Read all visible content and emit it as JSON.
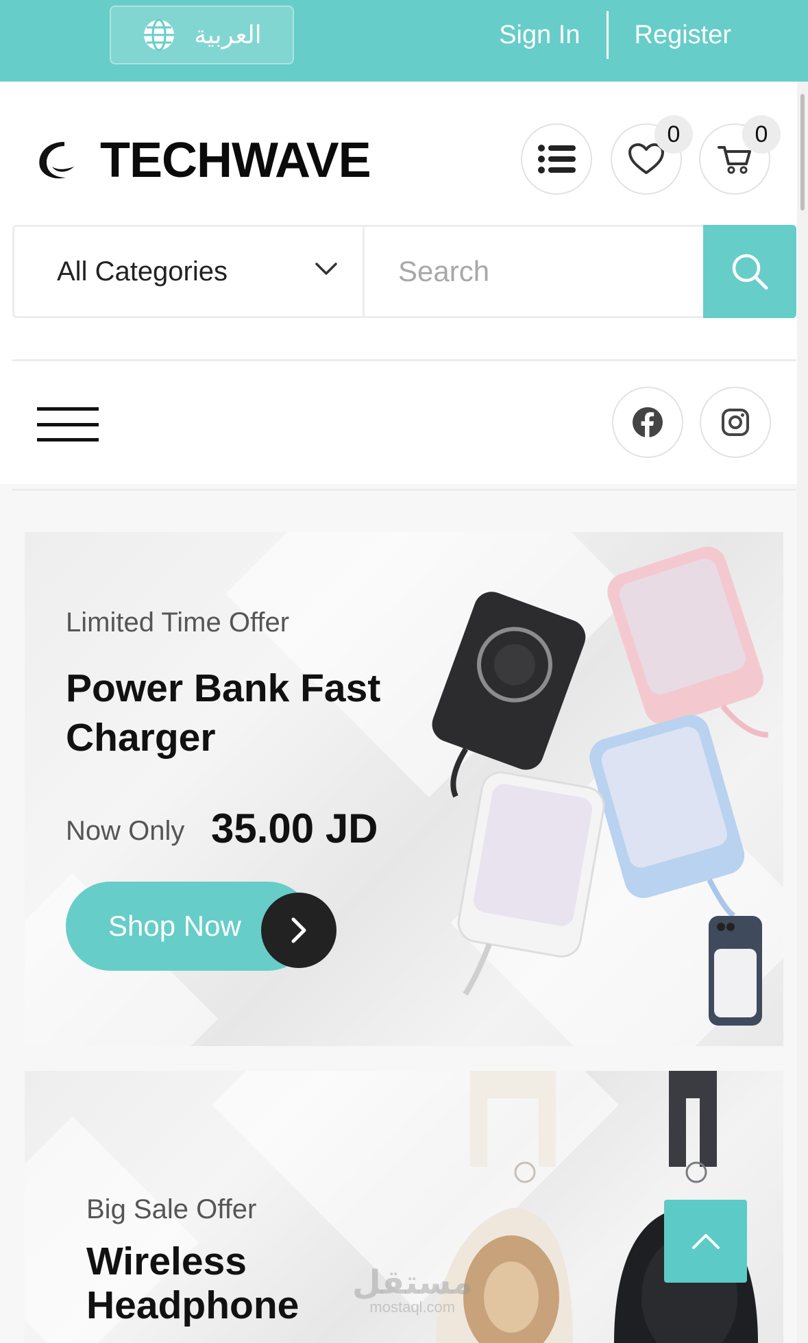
{
  "topbar": {
    "language_label": "العربية",
    "sign_in": "Sign In",
    "register": "Register",
    "color": "#66cdc9"
  },
  "header": {
    "brand": "TECHWAVE",
    "wishlist_count": "0",
    "cart_count": "0"
  },
  "search": {
    "category_selected": "All Categories",
    "placeholder": "Search"
  },
  "banners": [
    {
      "eyebrow": "Limited Time Offer",
      "title_line1": "Power Bank Fast",
      "title_line2": "Charger",
      "price_label": "Now Only",
      "price": "35.00 JD",
      "cta": "Shop Now"
    },
    {
      "eyebrow": "Big Sale Offer",
      "title_line1": "Wireless",
      "title_line2": "Headphone"
    }
  ],
  "watermark": {
    "arabic": "مستقل",
    "domain": "mostaql.com"
  }
}
